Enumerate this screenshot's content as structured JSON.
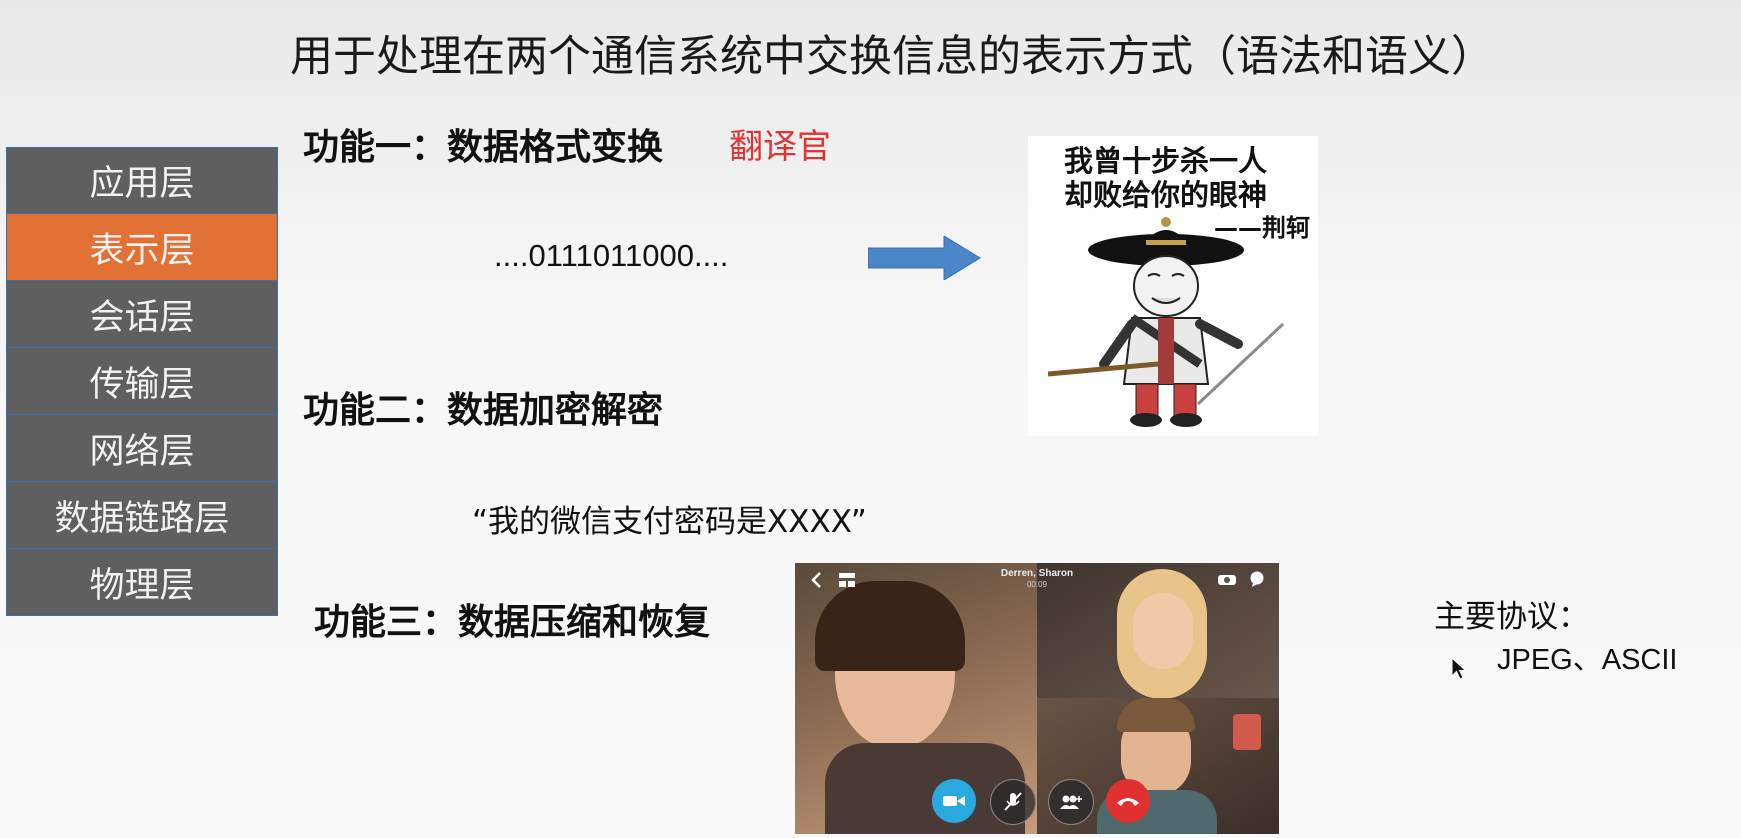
{
  "slide": {
    "title": "用于处理在两个通信系统中交换信息的表示方式（语法和语义）"
  },
  "layers": [
    {
      "label": "应用层",
      "active": false
    },
    {
      "label": "表示层",
      "active": true
    },
    {
      "label": "会话层",
      "active": false
    },
    {
      "label": "传输层",
      "active": false
    },
    {
      "label": "网络层",
      "active": false
    },
    {
      "label": "数据链路层",
      "active": false
    },
    {
      "label": "物理层",
      "active": false
    }
  ],
  "functions": [
    {
      "label": "功能一：数据格式变换",
      "note": "翻译官"
    },
    {
      "label": "功能二：数据加密解密"
    },
    {
      "label": "功能三：数据压缩和恢复"
    }
  ],
  "binary_example": "....0111011000....",
  "quote_example": "“我的微信支付密码是XXXX”",
  "meme": {
    "line1": "我曾十步杀一人",
    "line2": "却败给你的眼神",
    "signature": "——荆轲"
  },
  "video_call": {
    "participants": "Derren, Sharon",
    "duration": "00:09"
  },
  "protocols": {
    "title": "主要协议：",
    "values": "JPEG、ASCII"
  },
  "colors": {
    "layer_bg": "#5f5f5f",
    "layer_active_bg": "#e27135",
    "accent_red": "#e03434",
    "arrow_blue": "#4a86c8",
    "hangup_red": "#e03030",
    "video_blue": "#2aa8e0"
  },
  "icons": [
    "arrow-right-icon",
    "back-icon",
    "grid-icon",
    "switch-camera-icon",
    "chat-icon",
    "video-camera-icon",
    "mute-mic-icon",
    "add-people-icon",
    "hang-up-icon",
    "mouse-cursor-icon"
  ]
}
